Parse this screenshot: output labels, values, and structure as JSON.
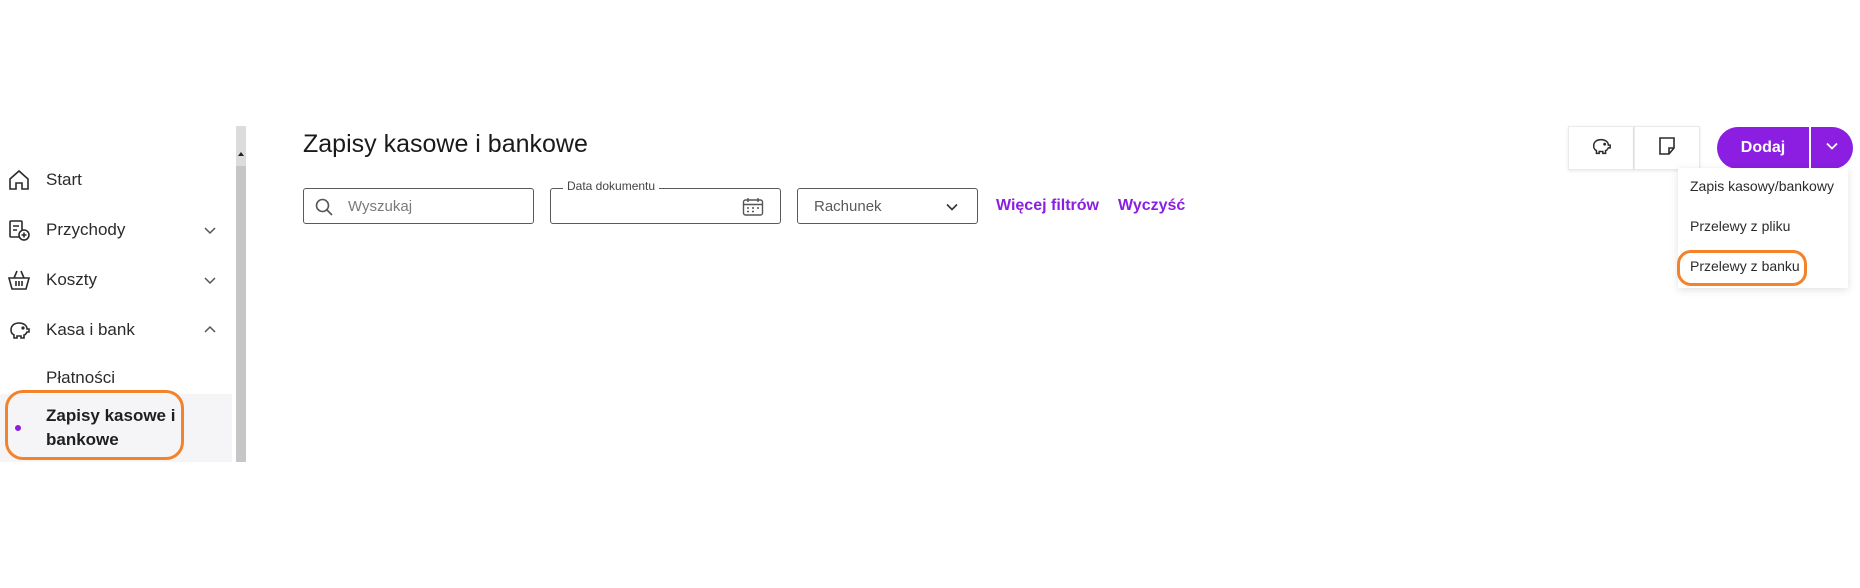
{
  "sidebar": {
    "items": [
      {
        "label": "Start",
        "icon": "home-icon"
      },
      {
        "label": "Przychody",
        "icon": "income-icon"
      },
      {
        "label": "Koszty",
        "icon": "basket-icon"
      },
      {
        "label": "Kasa i bank",
        "icon": "piggy-bank-icon"
      }
    ],
    "subitems": [
      {
        "label": "Płatności"
      },
      {
        "label": "Zapisy kasowe i bankowe",
        "active": true
      }
    ]
  },
  "main": {
    "title": "Zapisy kasowe i bankowe",
    "filters": {
      "search_placeholder": "Wyszukaj",
      "date_label": "Data dokumentu",
      "account_placeholder": "Rachunek",
      "more_filters": "Więcej filtrów",
      "clear": "Wyczyść"
    }
  },
  "toolbar": {
    "add_label": "Dodaj",
    "dropdown": [
      "Zapis kasowy/bankowy",
      "Przelewy z pliku",
      "Przelewy z banku"
    ]
  },
  "colors": {
    "accent": "#8b1ee0",
    "highlight": "#f3822a"
  }
}
